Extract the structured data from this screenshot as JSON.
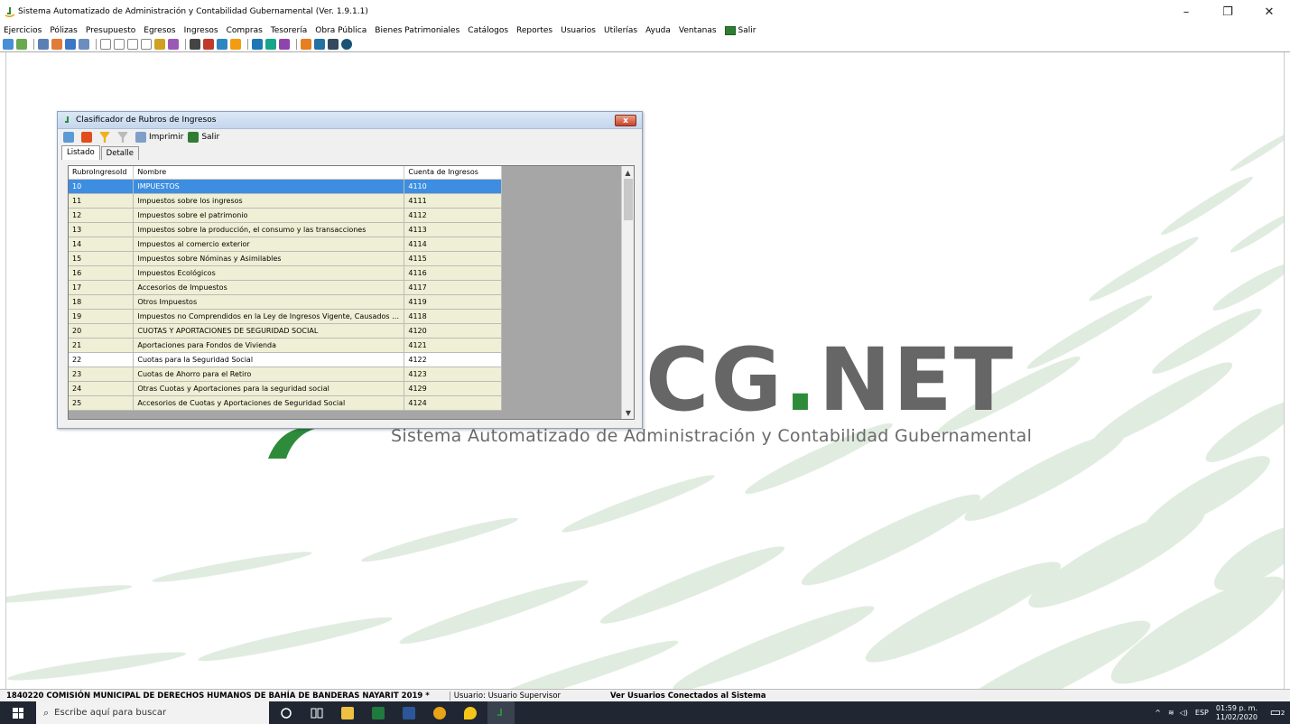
{
  "window": {
    "title": "Sistema Automatizado de Administración y Contabilidad Gubernamental  (Ver. 1.9.1.1)",
    "minimize": "–",
    "maximize": "❐",
    "close": "✕"
  },
  "menu": {
    "items": [
      "Ejercicios",
      "Pólizas",
      "Presupuesto",
      "Egresos",
      "Ingresos",
      "Compras",
      "Tesorería",
      "Obra Pública",
      "Bienes Patrimoniales",
      "Catálogos",
      "Reportes",
      "Usuarios",
      "Utilerías",
      "Ayuda",
      "Ventanas"
    ],
    "salir": "Salir"
  },
  "logo": {
    "brand_left": "CG",
    "brand_dot": ".",
    "brand_right": "NET",
    "subtitle": "Sistema Automatizado de Administración y Contabilidad Gubernamental"
  },
  "dialog": {
    "title": "Clasificador de Rubros de Ingresos",
    "close_label": "x",
    "print_label": "Imprimir",
    "exit_label": "Salir",
    "tabs": [
      "Listado",
      "Detalle"
    ],
    "columns": [
      "RubroIngresoId",
      "Nombre",
      "Cuenta de Ingresos"
    ],
    "rows": [
      {
        "id": "10",
        "nombre": "IMPUESTOS",
        "cuenta": "4110"
      },
      {
        "id": "11",
        "nombre": "Impuestos sobre los ingresos",
        "cuenta": "4111"
      },
      {
        "id": "12",
        "nombre": "Impuestos sobre el patrimonio",
        "cuenta": "4112"
      },
      {
        "id": "13",
        "nombre": "Impuestos sobre la producción, el consumo y las transacciones",
        "cuenta": "4113"
      },
      {
        "id": "14",
        "nombre": "Impuestos al comercio exterior",
        "cuenta": "4114"
      },
      {
        "id": "15",
        "nombre": "Impuestos sobre Nóminas y Asimilables",
        "cuenta": "4115"
      },
      {
        "id": "16",
        "nombre": "Impuestos Ecológicos",
        "cuenta": "4116"
      },
      {
        "id": "17",
        "nombre": "Accesorios de Impuestos",
        "cuenta": "4117"
      },
      {
        "id": "18",
        "nombre": "Otros Impuestos",
        "cuenta": "4119"
      },
      {
        "id": "19",
        "nombre": "Impuestos no Comprendidos en la Ley de Ingresos Vigente, Causados en Ejercici...",
        "cuenta": "4118"
      },
      {
        "id": "20",
        "nombre": "CUOTAS Y APORTACIONES DE SEGURIDAD SOCIAL",
        "cuenta": "4120"
      },
      {
        "id": "21",
        "nombre": "Aportaciones para Fondos de Vivienda",
        "cuenta": "4121"
      },
      {
        "id": "22",
        "nombre": "Cuotas para la Seguridad Social",
        "cuenta": "4122"
      },
      {
        "id": "23",
        "nombre": "Cuotas de Ahorro para el Retiro",
        "cuenta": "4123"
      },
      {
        "id": "24",
        "nombre": "Otras Cuotas y Aportaciones para la seguridad social",
        "cuenta": "4129"
      },
      {
        "id": "25",
        "nombre": "Accesorios de Cuotas y Aportaciones de Seguridad Social",
        "cuenta": "4124"
      }
    ]
  },
  "status": {
    "organization": "1840220 COMISIÓN MUNICIPAL DE DERECHOS HUMANOS DE BAHÍA DE BANDERAS NAYARIT  2019  *",
    "user": "Usuario: Usuario Supervisor",
    "connected_users_link": "Ver Usuarios Conectados al Sistema"
  },
  "taskbar": {
    "search_placeholder": "Escribe aquí para buscar",
    "language": "ESP",
    "time": "01:59 p. m.",
    "date": "11/02/2020",
    "notification_count": "2"
  },
  "colors": {
    "accent_green": "#2e8b3a",
    "selected_row": "#3d8ee0",
    "alt_row": "#efefd5",
    "taskbar": "#202733"
  }
}
